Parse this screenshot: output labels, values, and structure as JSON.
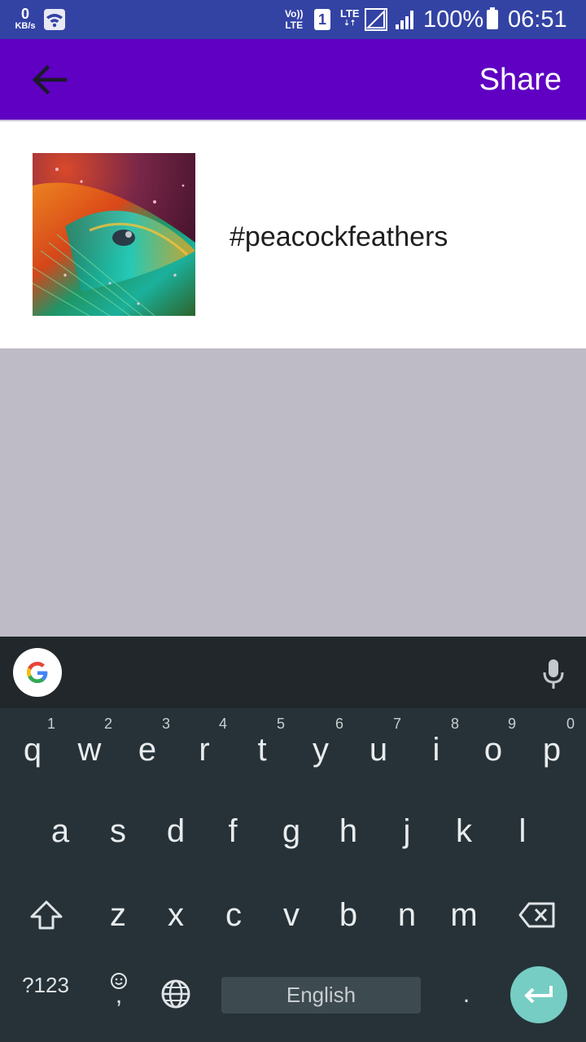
{
  "status_bar": {
    "speed_value": "0",
    "speed_unit": "KB/s",
    "volte_top": "Vo))",
    "volte_bottom": "LTE",
    "sim_slot": "1",
    "lte_label": "LTE",
    "battery": "100%",
    "time": "06:51"
  },
  "app_bar": {
    "share_label": "Share",
    "back_icon": "arrow-back-icon"
  },
  "post": {
    "caption": "#peacockfeathers",
    "thumbnail": "peacock-feather-image"
  },
  "keyboard": {
    "row1": [
      {
        "key": "q",
        "hint": "1"
      },
      {
        "key": "w",
        "hint": "2"
      },
      {
        "key": "e",
        "hint": "3"
      },
      {
        "key": "r",
        "hint": "4"
      },
      {
        "key": "t",
        "hint": "5"
      },
      {
        "key": "y",
        "hint": "6"
      },
      {
        "key": "u",
        "hint": "7"
      },
      {
        "key": "i",
        "hint": "8"
      },
      {
        "key": "o",
        "hint": "9"
      },
      {
        "key": "p",
        "hint": "0"
      }
    ],
    "row2": [
      "a",
      "s",
      "d",
      "f",
      "g",
      "h",
      "j",
      "k",
      "l"
    ],
    "row3": [
      "z",
      "x",
      "c",
      "v",
      "b",
      "n",
      "m"
    ],
    "symbols_label": "?123",
    "emoji_comma": ",",
    "space_label": "English",
    "period": "."
  },
  "colors": {
    "status_bar": "#3343a4",
    "app_bar": "#5f00c2",
    "keyboard_bg": "#263238",
    "enter_accent": "#76cdc3"
  }
}
